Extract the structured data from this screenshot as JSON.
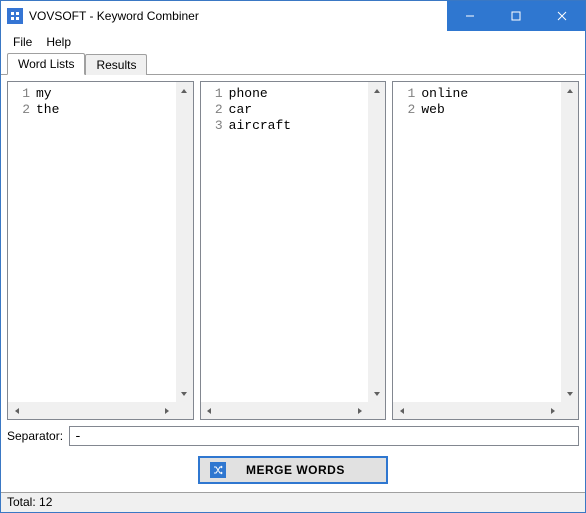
{
  "window": {
    "title": "VOVSOFT - Keyword Combiner"
  },
  "menu": {
    "file": "File",
    "help": "Help"
  },
  "tabs": {
    "word_lists": "Word Lists",
    "results": "Results"
  },
  "lists": [
    {
      "lines": [
        "my",
        "the"
      ]
    },
    {
      "lines": [
        "phone",
        "car",
        "aircraft"
      ]
    },
    {
      "lines": [
        "online",
        "web"
      ]
    }
  ],
  "separator": {
    "label": "Separator:",
    "value": "-"
  },
  "merge": {
    "label": "MERGE WORDS"
  },
  "status": {
    "total_label": "Total:",
    "total_value": "12"
  }
}
